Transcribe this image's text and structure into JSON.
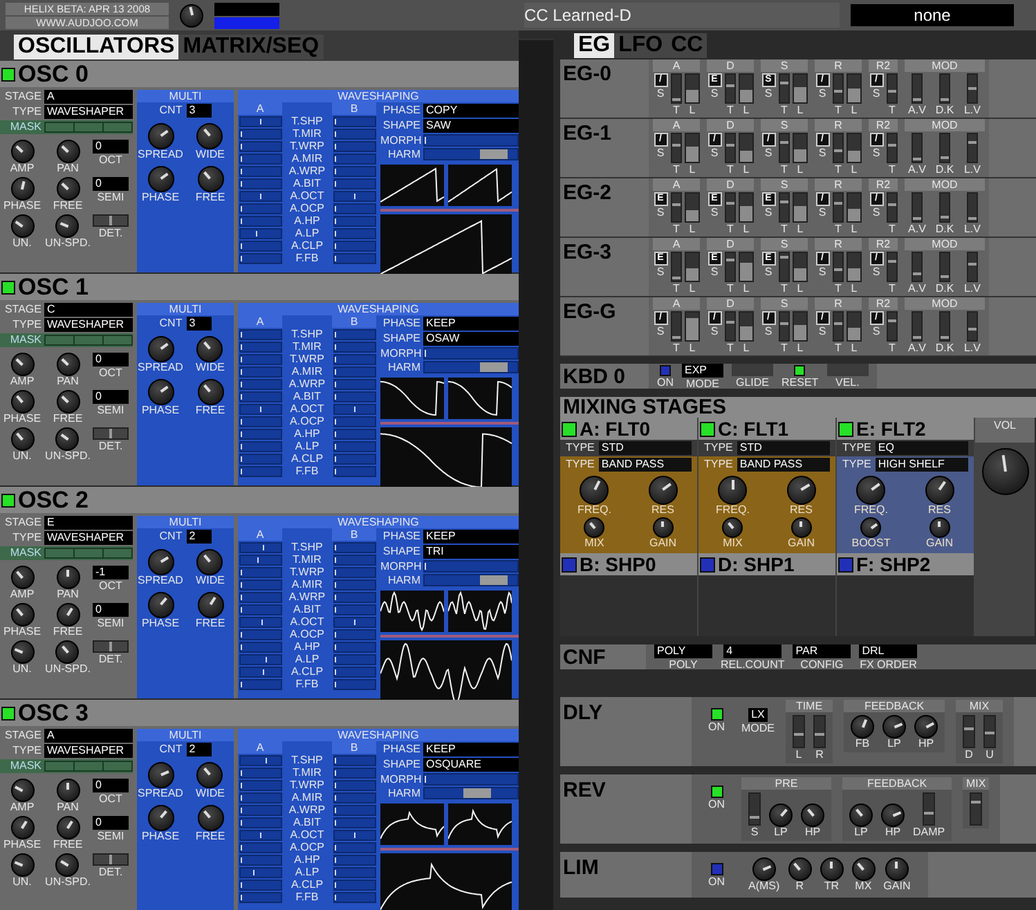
{
  "header": {
    "version": "HELIX BETA: APR 13 2008",
    "website": "WWW.AUDJOO.COM",
    "master": {
      "level": 0.45
    }
  },
  "cc": {
    "label": "CC Learned-D",
    "value": "none"
  },
  "left_tabs": [
    {
      "label": "OSCILLATORS",
      "selected": true
    },
    {
      "label": "MATRIX/SEQ",
      "selected": false
    }
  ],
  "oscillators": [
    {
      "name": "OSC 0",
      "on": true,
      "stage": {
        "label": "STAGE",
        "value": "A"
      },
      "type": {
        "label": "TYPE",
        "value": "WAVESHAPER"
      },
      "mask": {
        "label": "MASK"
      },
      "oct": {
        "label": "OCT",
        "value": "0"
      },
      "semi": {
        "label": "SEMI",
        "value": "0"
      },
      "det": {
        "label": "DET.",
        "level": 0.5
      },
      "knobs": [
        {
          "label": "AMP",
          "level": 0.33
        },
        {
          "label": "PAN",
          "level": 0.33
        },
        {
          "label": "PHASE",
          "level": 0.55
        },
        {
          "label": "FREE",
          "level": 0.33
        },
        {
          "label": "UN.",
          "level": 0.3
        },
        {
          "label": "UN-SPD.",
          "level": 0.25
        }
      ],
      "multi": {
        "title": "MULTI",
        "cnt_label": "CNT",
        "cnt": "3",
        "knobs": [
          {
            "label": "SPREAD",
            "level": 0.7
          },
          {
            "label": "WIDE",
            "level": 0.35
          },
          {
            "label": "PHASE",
            "level": 0.7
          },
          {
            "label": "FREE",
            "level": 0.35
          }
        ]
      },
      "ws": {
        "title": "WAVESHAPING",
        "col_a": "A",
        "col_b": "B",
        "phase": {
          "label": "PHASE",
          "value": "COPY"
        },
        "shape": {
          "label": "SHAPE",
          "value": "SAW"
        },
        "morph": {
          "label": "MORPH",
          "level": 0
        },
        "harm": {
          "label": "HARM",
          "level": 0.85
        },
        "params": [
          {
            "label": "T.SHP",
            "a": {
              "level": 0.5
            },
            "b": {
              "level": 0
            }
          },
          {
            "label": "T.MIR",
            "a": {
              "level": 0
            },
            "b": {
              "level": 0
            }
          },
          {
            "label": "T.WRP",
            "a": {
              "level": 0
            },
            "b": {
              "level": 0
            }
          },
          {
            "label": "A.MIR",
            "a": {
              "level": 0
            },
            "b": {
              "level": 0
            }
          },
          {
            "label": "A.WRP",
            "a": {
              "level": 0
            },
            "b": {
              "level": 0
            }
          },
          {
            "label": "A.BIT",
            "a": {
              "level": 0
            },
            "b": {
              "level": 0
            }
          },
          {
            "label": "A.OCT",
            "a": {
              "level": 0.5
            },
            "b": {
              "level": 0.5
            }
          },
          {
            "label": "A.OCP",
            "a": {
              "level": 0
            },
            "b": {
              "level": 0
            }
          },
          {
            "label": "A.HP",
            "a": {
              "level": 0
            },
            "b": {
              "level": 0
            }
          },
          {
            "label": "A.LP",
            "a": {
              "level": 0.4
            },
            "b": {
              "level": 0
            }
          },
          {
            "label": "A.CLP",
            "a": {
              "level": 0
            },
            "b": {
              "level": 0
            }
          },
          {
            "label": "F.FB",
            "a": {
              "level": 0
            },
            "b": {
              "level": 0
            }
          }
        ]
      }
    },
    {
      "name": "OSC 1",
      "on": true,
      "stage": {
        "label": "STAGE",
        "value": "C"
      },
      "type": {
        "label": "TYPE",
        "value": "WAVESHAPER"
      },
      "mask": {
        "label": "MASK"
      },
      "oct": {
        "label": "OCT",
        "value": "0"
      },
      "semi": {
        "label": "SEMI",
        "value": "0"
      },
      "det": {
        "label": "DET.",
        "level": 0.5
      },
      "knobs": [
        {
          "label": "AMP",
          "level": 0.33
        },
        {
          "label": "PAN",
          "level": 0.33
        },
        {
          "label": "PHASE",
          "level": 0.35
        },
        {
          "label": "FREE",
          "level": 0.33
        },
        {
          "label": "UN.",
          "level": 0.35
        },
        {
          "label": "UN-SPD.",
          "level": 0.3
        }
      ],
      "multi": {
        "title": "MULTI",
        "cnt_label": "CNT",
        "cnt": "3",
        "knobs": [
          {
            "label": "SPREAD",
            "level": 0.7
          },
          {
            "label": "WIDE",
            "level": 0.35
          },
          {
            "label": "PHASE",
            "level": 0.7
          },
          {
            "label": "FREE",
            "level": 0.35
          }
        ]
      },
      "ws": {
        "title": "WAVESHAPING",
        "col_a": "A",
        "col_b": "B",
        "phase": {
          "label": "PHASE",
          "value": "KEEP"
        },
        "shape": {
          "label": "SHAPE",
          "value": "OSAW"
        },
        "morph": {
          "label": "MORPH",
          "level": 0
        },
        "harm": {
          "label": "HARM",
          "level": 0.85
        },
        "params": [
          {
            "label": "T.SHP",
            "a": {
              "level": 0
            },
            "b": {
              "level": 0
            }
          },
          {
            "label": "T.MIR",
            "a": {
              "level": 0
            },
            "b": {
              "level": 0
            }
          },
          {
            "label": "T.WRP",
            "a": {
              "level": 0
            },
            "b": {
              "level": 0
            }
          },
          {
            "label": "A.MIR",
            "a": {
              "level": 0
            },
            "b": {
              "level": 0
            }
          },
          {
            "label": "A.WRP",
            "a": {
              "level": 0
            },
            "b": {
              "level": 0
            }
          },
          {
            "label": "A.BIT",
            "a": {
              "level": 0
            },
            "b": {
              "level": 0
            }
          },
          {
            "label": "A.OCT",
            "a": {
              "level": 0.5
            },
            "b": {
              "level": 0.5
            }
          },
          {
            "label": "A.OCP",
            "a": {
              "level": 0
            },
            "b": {
              "level": 0
            }
          },
          {
            "label": "A.HP",
            "a": {
              "level": 0
            },
            "b": {
              "level": 0
            }
          },
          {
            "label": "A.LP",
            "a": {
              "level": 0
            },
            "b": {
              "level": 0
            }
          },
          {
            "label": "A.CLP",
            "a": {
              "level": 0
            },
            "b": {
              "level": 0
            }
          },
          {
            "label": "F.FB",
            "a": {
              "level": 0
            },
            "b": {
              "level": 0
            }
          }
        ]
      }
    },
    {
      "name": "OSC 2",
      "on": true,
      "stage": {
        "label": "STAGE",
        "value": "E"
      },
      "type": {
        "label": "TYPE",
        "value": "WAVESHAPER"
      },
      "mask": {
        "label": "MASK"
      },
      "oct": {
        "label": "OCT",
        "value": "-1"
      },
      "semi": {
        "label": "SEMI",
        "value": "0"
      },
      "det": {
        "label": "DET.",
        "level": 0.5
      },
      "knobs": [
        {
          "label": "AMP",
          "level": 0.35
        },
        {
          "label": "PAN",
          "level": 0.5
        },
        {
          "label": "PHASE",
          "level": 0.35
        },
        {
          "label": "FREE",
          "level": 0.62
        },
        {
          "label": "UN.",
          "level": 0.25
        },
        {
          "label": "UN-SPD.",
          "level": 0.35
        }
      ],
      "multi": {
        "title": "MULTI",
        "cnt_label": "CNT",
        "cnt": "2",
        "knobs": [
          {
            "label": "SPREAD",
            "level": 0.72
          },
          {
            "label": "WIDE",
            "level": 0.35
          },
          {
            "label": "PHASE",
            "level": 0.65
          },
          {
            "label": "FREE",
            "level": 0.62
          }
        ]
      },
      "ws": {
        "title": "WAVESHAPING",
        "col_a": "A",
        "col_b": "B",
        "phase": {
          "label": "PHASE",
          "value": "KEEP"
        },
        "shape": {
          "label": "SHAPE",
          "value": "TRI"
        },
        "morph": {
          "label": "MORPH",
          "level": 0
        },
        "harm": {
          "label": "HARM",
          "level": 0.85
        },
        "params": [
          {
            "label": "T.SHP",
            "a": {
              "level": 0.6
            },
            "b": {
              "level": 0
            }
          },
          {
            "label": "T.MIR",
            "a": {
              "level": 0.45
            },
            "b": {
              "level": 0
            }
          },
          {
            "label": "T.WRP",
            "a": {
              "level": 0
            },
            "b": {
              "level": 0
            }
          },
          {
            "label": "A.MIR",
            "a": {
              "level": 0
            },
            "b": {
              "level": 0
            }
          },
          {
            "label": "A.WRP",
            "a": {
              "level": 0
            },
            "b": {
              "level": 0
            }
          },
          {
            "label": "A.BIT",
            "a": {
              "level": 0
            },
            "b": {
              "level": 0
            }
          },
          {
            "label": "A.OCT",
            "a": {
              "level": 0.55
            },
            "b": {
              "level": 0.5
            }
          },
          {
            "label": "A.OCP",
            "a": {
              "level": 0
            },
            "b": {
              "level": 0
            }
          },
          {
            "label": "A.HP",
            "a": {
              "level": 0
            },
            "b": {
              "level": 0
            }
          },
          {
            "label": "A.LP",
            "a": {
              "level": 0.65
            },
            "b": {
              "level": 0
            }
          },
          {
            "label": "A.CLP",
            "a": {
              "level": 0.6
            },
            "b": {
              "level": 0
            }
          },
          {
            "label": "F.FB",
            "a": {
              "level": 0
            },
            "b": {
              "level": 0
            }
          }
        ]
      }
    },
    {
      "name": "OSC 3",
      "on": true,
      "stage": {
        "label": "STAGE",
        "value": "A"
      },
      "type": {
        "label": "TYPE",
        "value": "WAVESHAPER"
      },
      "mask": {
        "label": "MASK"
      },
      "oct": {
        "label": "OCT",
        "value": "0"
      },
      "semi": {
        "label": "SEMI",
        "value": "0"
      },
      "det": {
        "label": "DET.",
        "level": 0.5
      },
      "knobs": [
        {
          "label": "AMP",
          "level": 0.27
        },
        {
          "label": "PAN",
          "level": 0.5
        },
        {
          "label": "PHASE",
          "level": 0.62
        },
        {
          "label": "FREE",
          "level": 0.62
        },
        {
          "label": "UN.",
          "level": 0.25
        },
        {
          "label": "UN-SPD.",
          "level": 0.28
        }
      ],
      "multi": {
        "title": "MULTI",
        "cnt_label": "CNT",
        "cnt": "2",
        "knobs": [
          {
            "label": "SPREAD",
            "level": 0.75
          },
          {
            "label": "WIDE",
            "level": 0.35
          },
          {
            "label": "PHASE",
            "level": 0.65
          },
          {
            "label": "FREE",
            "level": 0.35
          }
        ]
      },
      "ws": {
        "title": "WAVESHAPING",
        "col_a": "A",
        "col_b": "B",
        "phase": {
          "label": "PHASE",
          "value": "KEEP"
        },
        "shape": {
          "label": "SHAPE",
          "value": "OSQUARE"
        },
        "morph": {
          "label": "MORPH",
          "level": 0
        },
        "harm": {
          "label": "HARM",
          "level": 0.6
        },
        "params": [
          {
            "label": "T.SHP",
            "a": {
              "level": 0.65
            },
            "b": {
              "level": 0
            }
          },
          {
            "label": "T.MIR",
            "a": {
              "level": 0
            },
            "b": {
              "level": 0
            }
          },
          {
            "label": "T.WRP",
            "a": {
              "level": 0
            },
            "b": {
              "level": 0
            }
          },
          {
            "label": "A.MIR",
            "a": {
              "level": 0
            },
            "b": {
              "level": 0
            }
          },
          {
            "label": "A.WRP",
            "a": {
              "level": 0
            },
            "b": {
              "level": 0
            }
          },
          {
            "label": "A.BIT",
            "a": {
              "level": 0
            },
            "b": {
              "level": 0
            }
          },
          {
            "label": "A.OCT",
            "a": {
              "level": 0.5
            },
            "b": {
              "level": 0.5
            }
          },
          {
            "label": "A.OCP",
            "a": {
              "level": 0
            },
            "b": {
              "level": 0
            }
          },
          {
            "label": "A.HP",
            "a": {
              "level": 0
            },
            "b": {
              "level": 0
            }
          },
          {
            "label": "A.LP",
            "a": {
              "level": 0.35
            },
            "b": {
              "level": 0
            }
          },
          {
            "label": "A.CLP",
            "a": {
              "level": 0
            },
            "b": {
              "level": 0
            }
          },
          {
            "label": "F.FB",
            "a": {
              "level": 0
            },
            "b": {
              "level": 0
            }
          }
        ]
      }
    }
  ],
  "right_tabs": [
    {
      "label": "EG",
      "selected": true
    },
    {
      "label": "LFO",
      "selected": false
    },
    {
      "label": "CC",
      "selected": false
    }
  ],
  "envelopes": [
    {
      "name": "EG-0",
      "groups": [
        {
          "kind": "env",
          "label": "A",
          "mode": "/",
          "mode_label": "S",
          "faders": [
            {
              "label": "T",
              "level": 0.05
            },
            {
              "label": "L",
              "level": 0.45
            }
          ]
        },
        {
          "kind": "env",
          "label": "D",
          "mode": "E",
          "mode_label": "S",
          "faders": [
            {
              "label": "T",
              "level": 0.6
            },
            {
              "label": "L",
              "level": 0.45
            }
          ]
        },
        {
          "kind": "env",
          "label": "S",
          "mode": "S",
          "mode_label": "S",
          "faders": [
            {
              "label": "T",
              "level": 0.7
            },
            {
              "label": "L",
              "level": 0.55
            }
          ]
        },
        {
          "kind": "env",
          "label": "R",
          "mode": "/",
          "mode_label": "S",
          "faders": [
            {
              "label": "T",
              "level": 0.4
            },
            {
              "label": "L",
              "level": 0.5
            }
          ]
        },
        {
          "kind": "single",
          "label": "R2",
          "mode": "/",
          "mode_label": "S",
          "faders": [
            {
              "label": "T",
              "level": 0.4
            }
          ]
        },
        {
          "kind": "mod",
          "label": "MOD",
          "faders": [
            {
              "label": "A.V",
              "level": 0.05
            },
            {
              "label": "D.K",
              "level": 0.05
            },
            {
              "label": "L.V",
              "level": 0.5
            }
          ]
        }
      ]
    },
    {
      "name": "EG-1",
      "groups": [
        {
          "kind": "env",
          "label": "A",
          "mode": "/",
          "mode_label": "S",
          "faders": [
            {
              "label": "T",
              "level": 0.6
            },
            {
              "label": "L",
              "level": 0.55
            }
          ]
        },
        {
          "kind": "env",
          "label": "D",
          "mode": "/",
          "mode_label": "S",
          "faders": [
            {
              "label": "T",
              "level": 0.6
            },
            {
              "label": "L",
              "level": 0.4
            }
          ]
        },
        {
          "kind": "env",
          "label": "S",
          "mode": "/",
          "mode_label": "S",
          "faders": [
            {
              "label": "T",
              "level": 0.75
            },
            {
              "label": "L",
              "level": 0.45
            }
          ]
        },
        {
          "kind": "env",
          "label": "R",
          "mode": "/",
          "mode_label": "S",
          "faders": [
            {
              "label": "T",
              "level": 0.4
            },
            {
              "label": "L",
              "level": 0.4
            }
          ]
        },
        {
          "kind": "single",
          "label": "R2",
          "mode": "/",
          "mode_label": "S",
          "faders": [
            {
              "label": "T",
              "level": 0.6
            }
          ]
        },
        {
          "kind": "mod",
          "label": "MOD",
          "faders": [
            {
              "label": "A.V",
              "level": 0.05
            },
            {
              "label": "D.K",
              "level": 0.1
            },
            {
              "label": "L.V",
              "level": 0.75
            }
          ]
        }
      ]
    },
    {
      "name": "EG-2",
      "groups": [
        {
          "kind": "env",
          "label": "A",
          "mode": "E",
          "mode_label": "S",
          "faders": [
            {
              "label": "T",
              "level": 0.6
            },
            {
              "label": "L",
              "level": 0.4
            }
          ]
        },
        {
          "kind": "env",
          "label": "D",
          "mode": "E",
          "mode_label": "S",
          "faders": [
            {
              "label": "T",
              "level": 0.65
            },
            {
              "label": "L",
              "level": 0.55
            }
          ]
        },
        {
          "kind": "env",
          "label": "S",
          "mode": "E",
          "mode_label": "S",
          "faders": [
            {
              "label": "T",
              "level": 0.7
            },
            {
              "label": "L",
              "level": 0.55
            }
          ]
        },
        {
          "kind": "env",
          "label": "R",
          "mode": "/",
          "mode_label": "S",
          "faders": [
            {
              "label": "T",
              "level": 0.65
            },
            {
              "label": "L",
              "level": 0.45
            }
          ]
        },
        {
          "kind": "single",
          "label": "R2",
          "mode": "/",
          "mode_label": "S",
          "faders": [
            {
              "label": "T",
              "level": 0.6
            }
          ]
        },
        {
          "kind": "mod",
          "label": "MOD",
          "faders": [
            {
              "label": "A.V",
              "level": 0.05
            },
            {
              "label": "D.K",
              "level": 0.1
            },
            {
              "label": "L.V",
              "level": 0.05
            }
          ]
        }
      ]
    },
    {
      "name": "EG-3",
      "groups": [
        {
          "kind": "env",
          "label": "A",
          "mode": "E",
          "mode_label": "S",
          "faders": [
            {
              "label": "T",
              "level": 0.05
            },
            {
              "label": "L",
              "level": 0.45
            }
          ]
        },
        {
          "kind": "env",
          "label": "D",
          "mode": "E",
          "mode_label": "S",
          "faders": [
            {
              "label": "T",
              "level": 0.8
            },
            {
              "label": "L",
              "level": 0.65
            }
          ]
        },
        {
          "kind": "env",
          "label": "S",
          "mode": "E",
          "mode_label": "S",
          "faders": [
            {
              "label": "T",
              "level": 0.9
            },
            {
              "label": "L",
              "level": 0.45
            }
          ]
        },
        {
          "kind": "env",
          "label": "R",
          "mode": "/",
          "mode_label": "S",
          "faders": [
            {
              "label": "T",
              "level": 0.4
            },
            {
              "label": "L",
              "level": 0.45
            }
          ]
        },
        {
          "kind": "single",
          "label": "R2",
          "mode": "/",
          "mode_label": "S",
          "faders": [
            {
              "label": "T",
              "level": 0.75
            }
          ]
        },
        {
          "kind": "mod",
          "label": "MOD",
          "faders": [
            {
              "label": "A.V",
              "level": 0.2
            },
            {
              "label": "D.K",
              "level": 0.1
            },
            {
              "label": "L.V",
              "level": 0.6
            }
          ]
        }
      ]
    },
    {
      "name": "EG-G",
      "groups": [
        {
          "kind": "env",
          "label": "A",
          "mode": "/",
          "mode_label": "S",
          "faders": [
            {
              "label": "T",
              "level": 0.05
            },
            {
              "label": "L",
              "level": 0.8
            }
          ]
        },
        {
          "kind": "env",
          "label": "D",
          "mode": "/",
          "mode_label": "S",
          "faders": [
            {
              "label": "T",
              "level": 0.65
            },
            {
              "label": "L",
              "level": 0.5
            }
          ]
        },
        {
          "kind": "env",
          "label": "S",
          "mode": "/",
          "mode_label": "S",
          "faders": [
            {
              "label": "T",
              "level": 0.6
            },
            {
              "label": "L",
              "level": 0.55
            }
          ]
        },
        {
          "kind": "env",
          "label": "R",
          "mode": "/",
          "mode_label": "S",
          "faders": [
            {
              "label": "T",
              "level": 0.6
            },
            {
              "label": "L",
              "level": 0.45
            }
          ]
        },
        {
          "kind": "single",
          "label": "R2",
          "mode": "/",
          "mode_label": "S",
          "faders": [
            {
              "label": "T",
              "level": 0.75
            }
          ]
        },
        {
          "kind": "mod",
          "label": "MOD",
          "faders": [
            {
              "label": "A.V",
              "level": 0.05
            },
            {
              "label": "D.K",
              "level": 0.05
            },
            {
              "label": "L.V",
              "level": 0.4
            }
          ]
        }
      ]
    }
  ],
  "keyboard": {
    "name": "KBD 0",
    "items": [
      {
        "kind": "led",
        "on": false,
        "label": "ON"
      },
      {
        "kind": "box",
        "value": "EXP",
        "label": "MODE"
      },
      {
        "kind": "box",
        "label": "GLIDE"
      },
      {
        "kind": "led",
        "on": true,
        "label": "RESET"
      },
      {
        "kind": "box",
        "label": "VEL."
      }
    ]
  },
  "mixing": {
    "title": "MIXING STAGES",
    "stages": [
      {
        "filter": {
          "name": "A: FLT0",
          "on": true,
          "color": "#8a6418",
          "type": {
            "label": "TYPE",
            "value": "STD"
          },
          "subtype": {
            "label": "TYPE",
            "value": "BAND PASS"
          },
          "knobs": [
            {
              "label": "FREQ.",
              "level": 0.6
            },
            {
              "label": "RES",
              "level": 0.7
            },
            {
              "label": "MIX",
              "level": 0.35
            },
            {
              "label": "GAIN",
              "level": 0.5
            }
          ]
        },
        "shaper": {
          "name": "B: SHP0",
          "on": false
        }
      },
      {
        "filter": {
          "name": "C: FLT1",
          "on": true,
          "color": "#8a6418",
          "type": {
            "label": "TYPE",
            "value": "STD"
          },
          "subtype": {
            "label": "TYPE",
            "value": "BAND PASS"
          },
          "knobs": [
            {
              "label": "FREQ.",
              "level": 0.5
            },
            {
              "label": "RES",
              "level": 0.72
            },
            {
              "label": "MIX",
              "level": 0.35
            },
            {
              "label": "GAIN",
              "level": 0.5
            }
          ]
        },
        "shaper": {
          "name": "D: SHP1",
          "on": false
        }
      },
      {
        "filter": {
          "name": "E: FLT2",
          "on": true,
          "color": "#4a5a8a",
          "type": {
            "label": "TYPE",
            "value": "EQ"
          },
          "subtype": {
            "label": "TYPE",
            "value": "HIGH SHELF"
          },
          "knobs": [
            {
              "label": "FREQ.",
              "level": 0.7
            },
            {
              "label": "RES",
              "level": 0.63
            },
            {
              "label": "BOOST",
              "level": 0.7
            },
            {
              "label": "GAIN",
              "level": 0.5
            }
          ]
        },
        "shaper": {
          "name": "F: SHP2",
          "on": false
        }
      }
    ],
    "volume": {
      "label": "VOL",
      "level": 0.47
    }
  },
  "config": {
    "name": "CNF",
    "items": [
      {
        "value": "POLY",
        "label": "POLY"
      },
      {
        "value": "4",
        "label": "REL.COUNT"
      },
      {
        "value": "PAR",
        "label": "CONFIG"
      },
      {
        "value": "DRL",
        "label": "FX ORDER"
      }
    ]
  },
  "effects": [
    {
      "name": "DLY",
      "power": {
        "on": true,
        "label": "ON"
      },
      "mode": {
        "value": "LX",
        "label": "MODE"
      },
      "groups": [
        {
          "title": "TIME",
          "items": [
            {
              "kind": "fader",
              "label": "L",
              "level": 0.4
            },
            {
              "kind": "fader",
              "label": "R",
              "level": 0.4
            }
          ]
        },
        {
          "title": "FEEDBACK",
          "items": [
            {
              "kind": "knob",
              "label": "FB",
              "level": 0.58
            },
            {
              "kind": "knob",
              "label": "LP",
              "level": 0.75
            },
            {
              "kind": "knob",
              "label": "HP",
              "level": 0.73
            }
          ]
        },
        {
          "title": "MIX",
          "items": [
            {
              "kind": "fader",
              "label": "D",
              "level": 0.6
            },
            {
              "kind": "fader",
              "label": "U",
              "level": 0.45
            }
          ]
        }
      ]
    },
    {
      "name": "REV",
      "power": {
        "on": true,
        "label": "ON"
      },
      "groups": [
        {
          "title": "PRE",
          "items": [
            {
              "kind": "fader",
              "label": "S",
              "level": 0.2
            },
            {
              "kind": "knob",
              "label": "LP",
              "level": 0.65
            },
            {
              "kind": "knob",
              "label": "HP",
              "level": 0.35
            }
          ]
        },
        {
          "title": "FEEDBACK",
          "items": [
            {
              "kind": "knob",
              "label": "LP",
              "level": 0.35
            },
            {
              "kind": "knob",
              "label": "HP",
              "level": 0.75
            },
            {
              "kind": "fader",
              "label": "DAMP",
              "level": 0.35
            }
          ]
        },
        {
          "title": "MIX",
          "items": [
            {
              "kind": "fader",
              "level": 0.75
            }
          ]
        }
      ]
    },
    {
      "name": "LIM",
      "power": {
        "on": false,
        "label": "ON"
      },
      "groups": [
        {
          "items": [
            {
              "kind": "knob",
              "label": "A(MS)",
              "level": 0.75
            },
            {
              "kind": "knob",
              "label": "R",
              "level": 0.35
            },
            {
              "kind": "knob",
              "label": "TR",
              "level": 0.5
            },
            {
              "kind": "knob",
              "label": "MX",
              "level": 0.35
            },
            {
              "kind": "knob",
              "label": "GAIN",
              "level": 0.5
            }
          ]
        }
      ]
    }
  ]
}
